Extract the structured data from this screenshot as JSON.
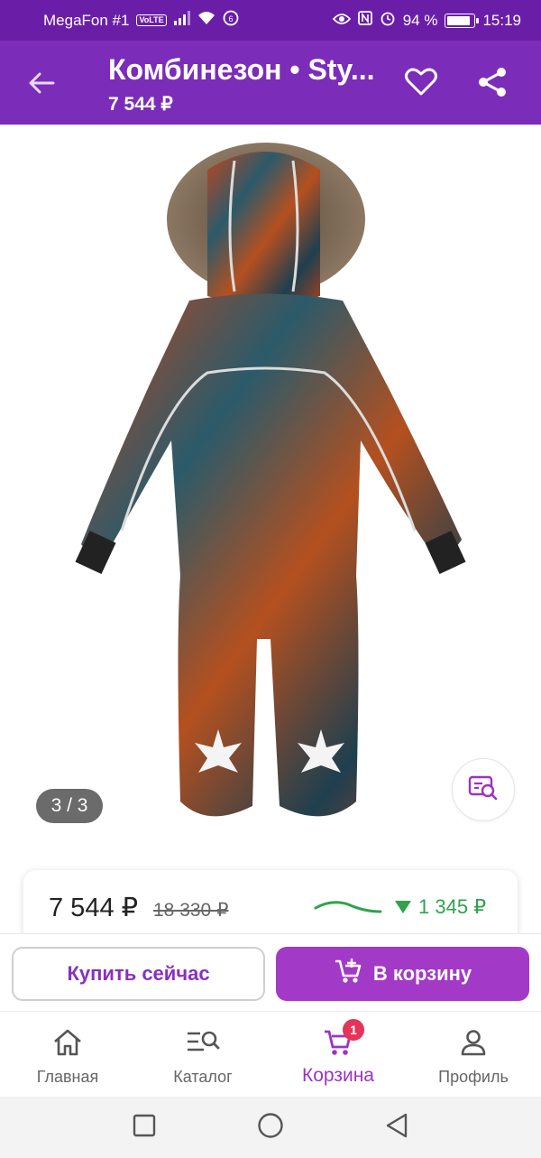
{
  "status_bar": {
    "carrier": "MegaFon #1",
    "volte": "VoLTE",
    "battery_percent_text": "94 %",
    "battery_level": 0.94,
    "time": "15:19"
  },
  "header": {
    "title": "Комбинезон • Sty...",
    "price": "7 544 ₽",
    "icons": [
      "arrow-left-icon",
      "heart-icon",
      "share-icon"
    ]
  },
  "gallery": {
    "counter": "3 / 3",
    "search_icon": "image-search-icon"
  },
  "price_card": {
    "price": "7 544 ₽",
    "old_price": "18 330 ₽",
    "drop": "1 345 ₽",
    "accent_green": "#2fa24b"
  },
  "actions": {
    "buy_now": "Купить сейчас",
    "add_to_cart": "В корзину"
  },
  "bottom_nav": {
    "items": [
      {
        "label": "Главная",
        "icon": "home-icon"
      },
      {
        "label": "Каталог",
        "icon": "catalog-search-icon"
      },
      {
        "label": "Корзина",
        "icon": "cart-icon",
        "badge": "1",
        "active": true
      },
      {
        "label": "Профиль",
        "icon": "profile-icon"
      }
    ]
  },
  "colors": {
    "header": "#7b2cb9",
    "status_bar": "#6a1ea8",
    "accent": "#a23ac7"
  }
}
